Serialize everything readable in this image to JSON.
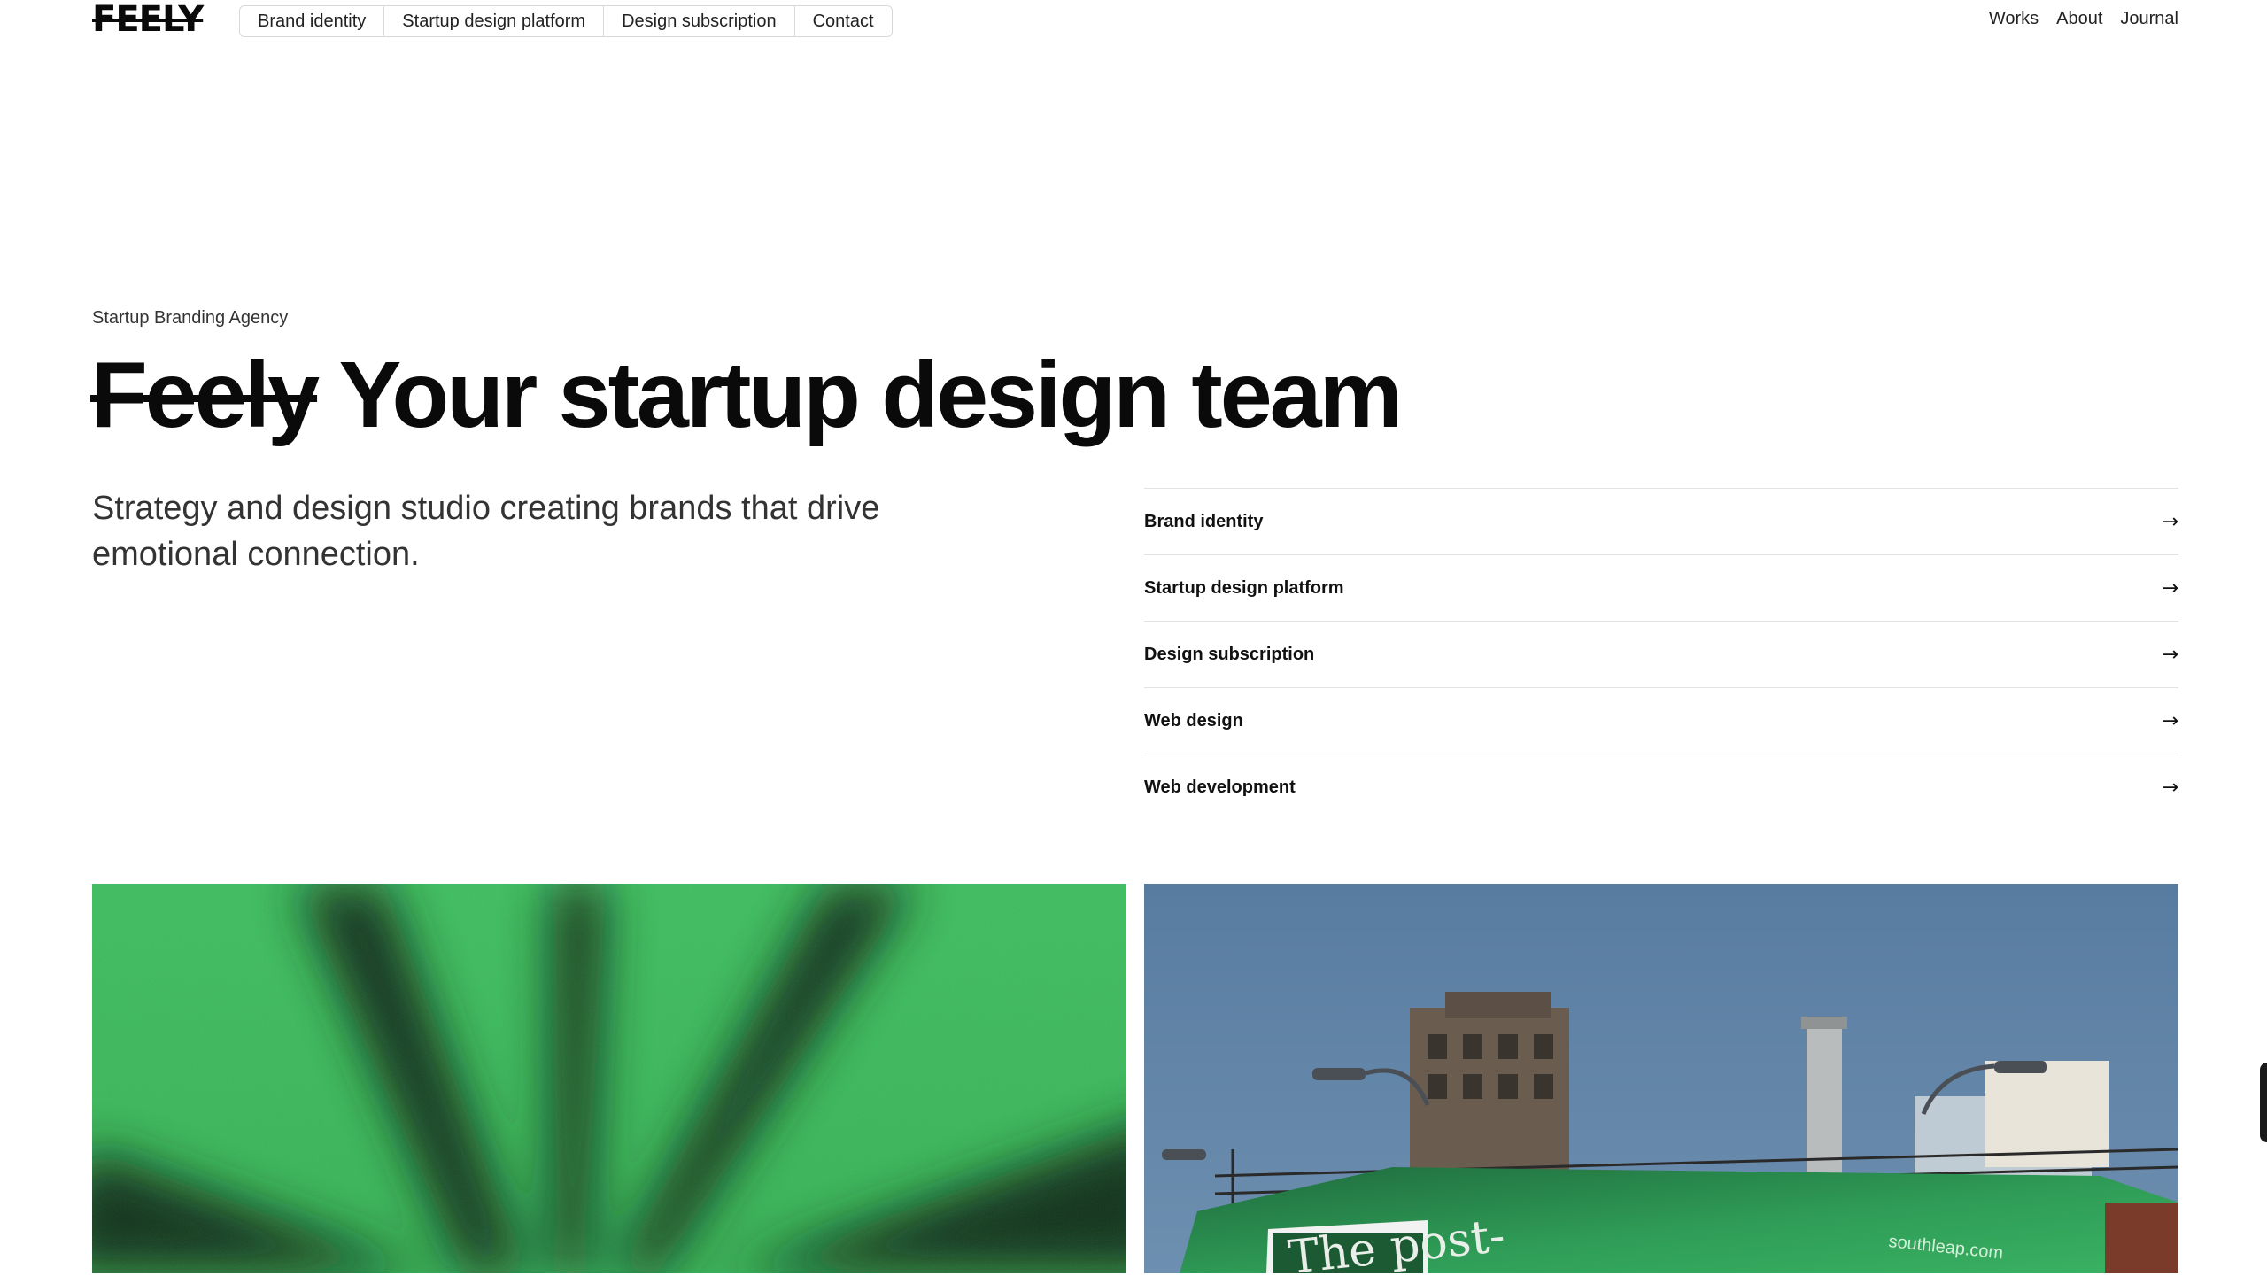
{
  "brand": {
    "logo_text": "FEELY"
  },
  "pill_nav": [
    {
      "label": "Brand identity"
    },
    {
      "label": "Startup design platform"
    },
    {
      "label": "Design subscription"
    },
    {
      "label": "Contact"
    }
  ],
  "right_nav": [
    {
      "label": "Works"
    },
    {
      "label": "About"
    },
    {
      "label": "Journal"
    }
  ],
  "hero": {
    "eyebrow": "Startup Branding Agency",
    "headline_struck": "Feely",
    "headline_main": "Your startup design team",
    "subtext": "Strategy and design studio creating brands that drive emotional connection."
  },
  "services": [
    {
      "label": "Brand identity",
      "arrow": "→"
    },
    {
      "label": "Startup design platform",
      "arrow": "→"
    },
    {
      "label": "Design subscription",
      "arrow": "→"
    },
    {
      "label": "Web design",
      "arrow": "→"
    },
    {
      "label": "Web development",
      "arrow": "→"
    }
  ],
  "images": {
    "right_billboard_text": "The post-",
    "right_billboard_url": "southleap.com"
  },
  "colors": {
    "accent_green": "#3db85c",
    "dark_green": "#0f2a18",
    "sky_blue": "#5c7fa1"
  }
}
